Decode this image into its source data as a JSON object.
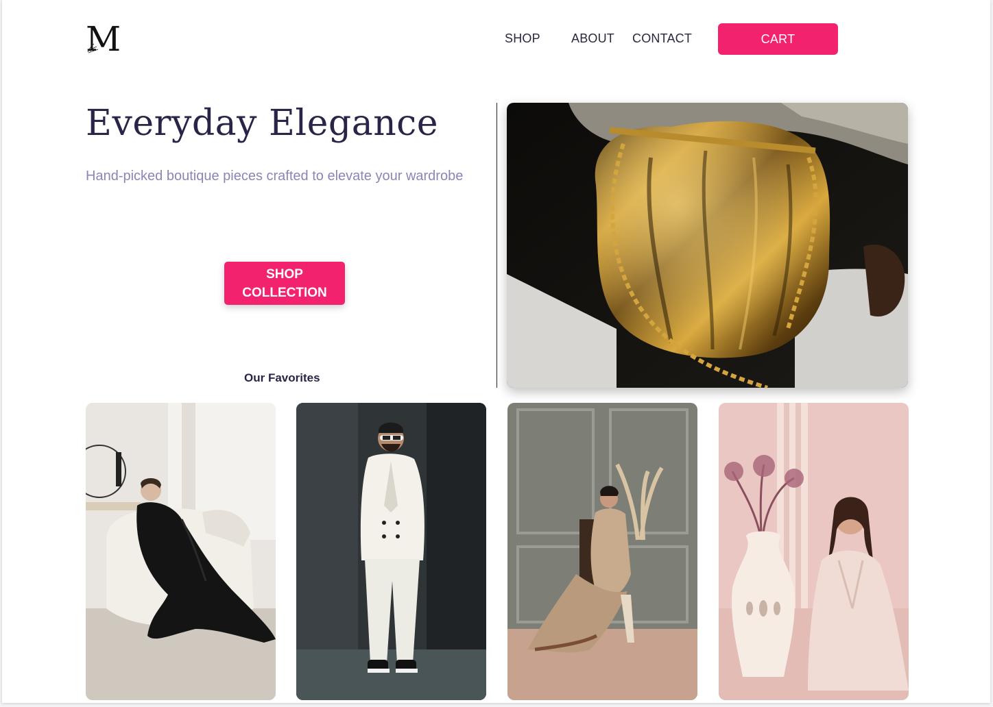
{
  "brand": {
    "logo_letter": "M",
    "logo_script": "𝓂"
  },
  "nav": {
    "shop": "SHOP",
    "about": "ABOUT",
    "contact": "CONTACT",
    "cart": "CART"
  },
  "hero": {
    "title": "Everyday Elegance",
    "subtitle": "Hand-picked boutique pieces crafted to elevate your wardrobe",
    "cta_line1": "SHOP",
    "cta_line2": "COLLECTION"
  },
  "favorites": {
    "heading": "Our Favorites"
  },
  "colors": {
    "accent": "#f2226f",
    "heading": "#2a2548",
    "subtitle": "#8a85b8"
  },
  "images": [
    "gold-handbag-photo",
    "black-abaya-photo",
    "white-suit-photo",
    "embroidered-suit-photo",
    "pink-dress-photo"
  ]
}
